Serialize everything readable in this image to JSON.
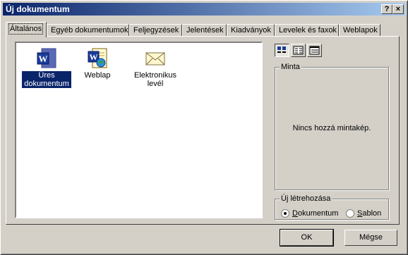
{
  "window": {
    "title": "Új dokumentum",
    "help_glyph": "?",
    "close_glyph": "×"
  },
  "tabs": [
    {
      "label": "Általános",
      "active": true
    },
    {
      "label": "Egyéb dokumentumok"
    },
    {
      "label": "Feljegyzések"
    },
    {
      "label": "Jelentések"
    },
    {
      "label": "Kiadványok"
    },
    {
      "label": "Levelek és faxok"
    },
    {
      "label": "Weblapok"
    }
  ],
  "templates": [
    {
      "label": "Üres dokumentum",
      "icon": "word-document-icon",
      "selected": true
    },
    {
      "label": "Weblap",
      "icon": "word-webpage-icon"
    },
    {
      "label": "Elektronikus levél",
      "icon": "email-envelope-icon"
    }
  ],
  "view_buttons": [
    "large-icons-view-icon",
    "list-view-icon",
    "details-view-icon"
  ],
  "preview": {
    "group_label": "Minta",
    "text": "Nincs hozzá mintakép."
  },
  "create_new": {
    "group_label": "Új létrehozása",
    "options": [
      {
        "label_u": "D",
        "label_rest": "okumentum",
        "selected": true
      },
      {
        "label_u": "S",
        "label_rest": "ablon",
        "selected": false
      }
    ]
  },
  "buttons": {
    "ok": "OK",
    "cancel": "Mégse"
  },
  "colors": {
    "titlebar_start": "#0a246a",
    "titlebar_end": "#a6caf0",
    "face": "#d4d0c8",
    "selection": "#0a246a"
  }
}
